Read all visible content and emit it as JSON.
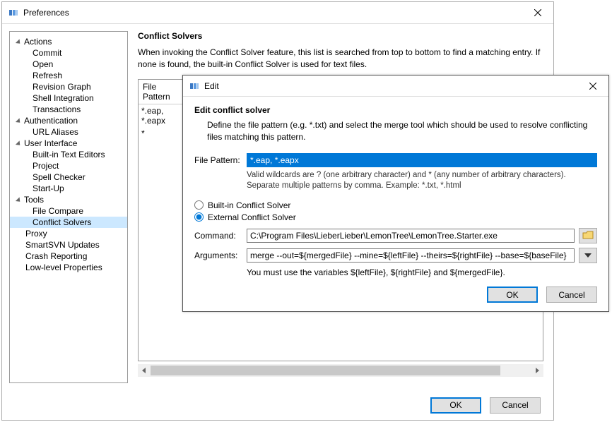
{
  "prefs": {
    "title": "Preferences",
    "sidebar": {
      "cats": [
        {
          "label": "Actions",
          "items": [
            "Commit",
            "Open",
            "Refresh",
            "Revision Graph",
            "Shell Integration",
            "Transactions"
          ]
        },
        {
          "label": "Authentication",
          "items": [
            "URL Aliases"
          ]
        },
        {
          "label": "User Interface",
          "items": [
            "Built-in Text Editors",
            "Project",
            "Spell Checker",
            "Start-Up"
          ]
        },
        {
          "label": "Tools",
          "items": [
            "File Compare",
            "Conflict Solvers"
          ]
        }
      ],
      "after": [
        "Proxy",
        "SmartSVN Updates",
        "Crash Reporting",
        "Low-level Properties"
      ],
      "selected": "Conflict Solvers"
    },
    "content": {
      "heading": "Conflict Solvers",
      "text": "When invoking the Conflict Solver feature, this list is searched from top to bottom to find a matching entry. If none is found, the built-in Conflict Solver is used for text files.",
      "col0": "File Pattern",
      "rows": [
        "*.eap, *.eapx",
        "*"
      ]
    },
    "ok": "OK",
    "cancel": "Cancel"
  },
  "edit": {
    "title": "Edit",
    "heading": "Edit conflict solver",
    "desc": "Define the file pattern (e.g. *.txt) and select the merge tool which should be used to resolve conflicting files matching this pattern.",
    "pattern_label": "File Pattern:",
    "pattern_value": "*.eap, *.eapx",
    "pattern_hint": "Valid wildcards are ? (one arbitrary character) and * (any number of arbitrary characters). Separate multiple patterns by comma. Example: *.txt, *.html",
    "radio_builtin": "Built-in Conflict Solver",
    "radio_external": "External Conflict Solver",
    "command_label": "Command:",
    "command_value": "C:\\Program Files\\LieberLieber\\LemonTree\\LemonTree.Starter.exe",
    "arguments_label": "Arguments:",
    "arguments_value": "merge --out=${mergedFile} --mine=${leftFile} --theirs=${rightFile} --base=${baseFile}",
    "varnote": "You must use the variables ${leftFile}, ${rightFile} and ${mergedFile}.",
    "ok": "OK",
    "cancel": "Cancel"
  }
}
